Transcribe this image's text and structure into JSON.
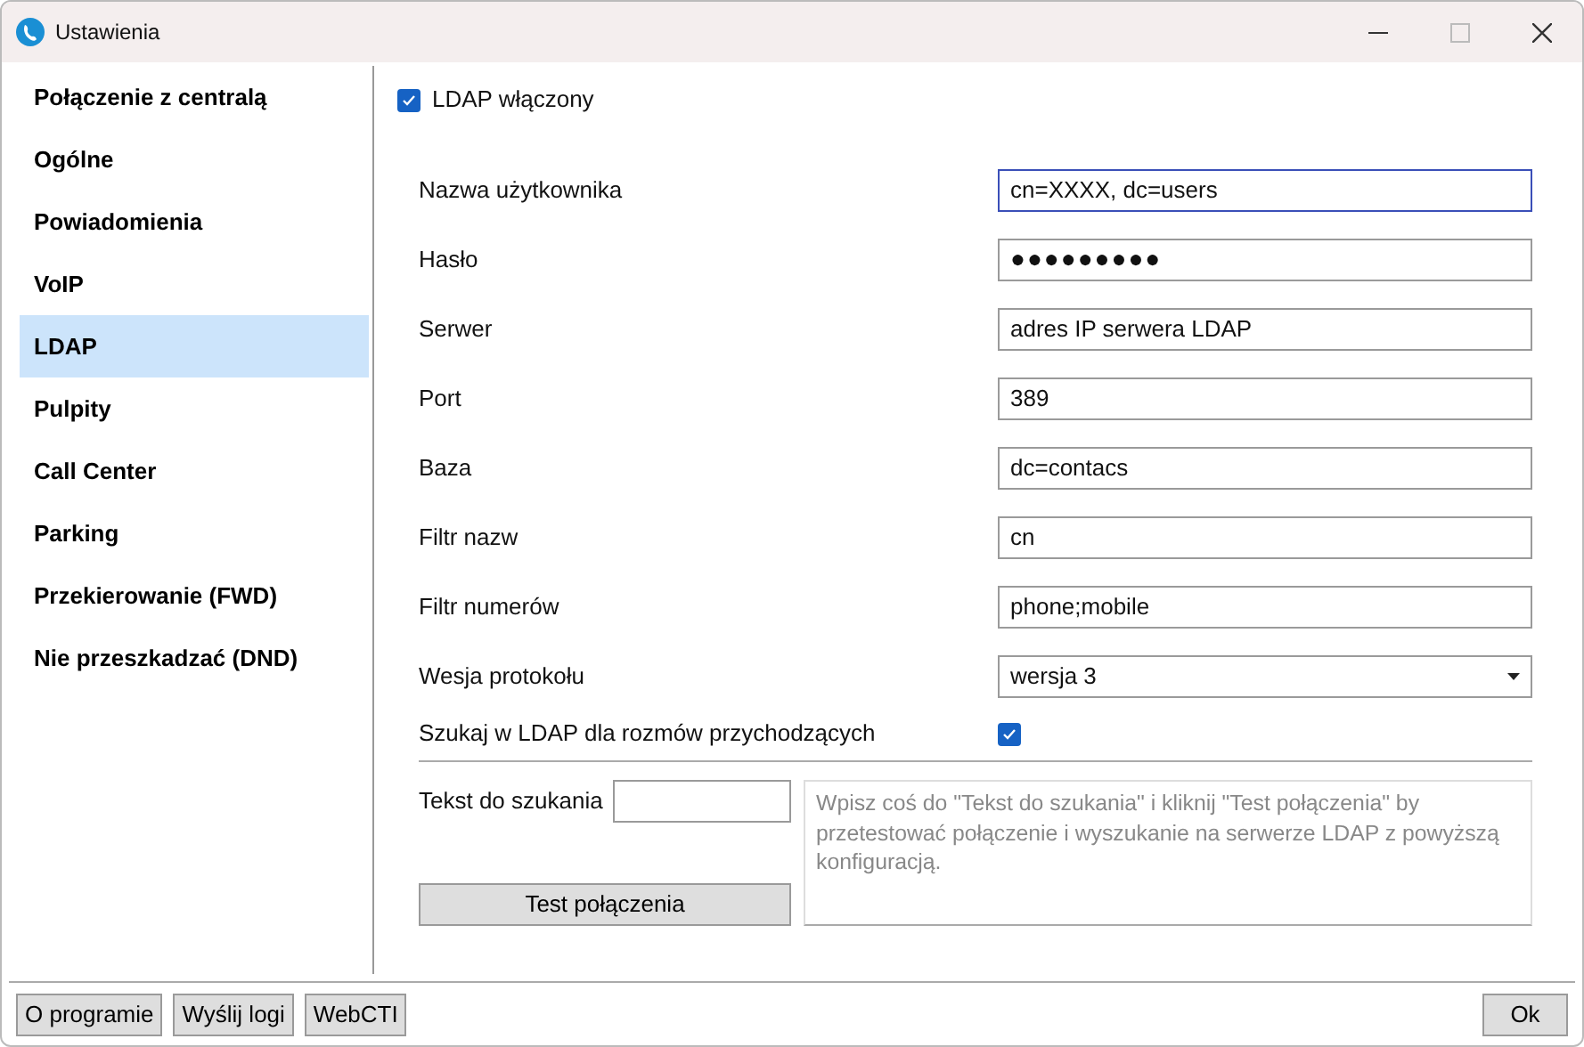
{
  "window": {
    "title": "Ustawienia"
  },
  "sidebar": {
    "items": [
      {
        "label": "Połączenie z centralą",
        "selected": false
      },
      {
        "label": "Ogólne",
        "selected": false
      },
      {
        "label": "Powiadomienia",
        "selected": false
      },
      {
        "label": "VoIP",
        "selected": false
      },
      {
        "label": "LDAP",
        "selected": true
      },
      {
        "label": "Pulpity",
        "selected": false
      },
      {
        "label": "Call Center",
        "selected": false
      },
      {
        "label": "Parking",
        "selected": false
      },
      {
        "label": "Przekierowanie (FWD)",
        "selected": false
      },
      {
        "label": "Nie przeszkadzać (DND)",
        "selected": false
      }
    ]
  },
  "ldap_enabled": {
    "label": "LDAP włączony",
    "checked": true
  },
  "fields": [
    {
      "kind": "text",
      "label": "Nazwa użytkownika",
      "value": "cn=XXXX, dc=users",
      "focused": true
    },
    {
      "kind": "password",
      "label": "Hasło",
      "value": "●●●●●●●●●",
      "focused": false
    },
    {
      "kind": "text",
      "label": "Serwer",
      "value": "adres IP serwera LDAP",
      "focused": false
    },
    {
      "kind": "text",
      "label": "Port",
      "value": "389",
      "focused": false
    },
    {
      "kind": "text",
      "label": "Baza",
      "value": "dc=contacs",
      "focused": false
    },
    {
      "kind": "text",
      "label": "Filtr nazw",
      "value": "cn",
      "focused": false
    },
    {
      "kind": "text",
      "label": "Filtr numerów",
      "value": "phone;mobile",
      "focused": false
    },
    {
      "kind": "select",
      "label": "Wesja protokołu",
      "value": "wersja 3",
      "focused": false
    }
  ],
  "incoming_search": {
    "label": "Szukaj w LDAP dla rozmów przychodzących",
    "checked": true
  },
  "test": {
    "label": "Tekst do szukania",
    "button": "Test połączenia",
    "result_placeholder": "Wpisz coś do \"Tekst do szukania\" i kliknij \"Test połączenia\" by przetestować połączenie i wyszukanie na serwerze LDAP z powyższą konfiguracją."
  },
  "footer": {
    "left_buttons": [
      "O programie",
      "Wyślij logi",
      "WebCTI"
    ],
    "right_buttons": [
      "Ok"
    ]
  }
}
